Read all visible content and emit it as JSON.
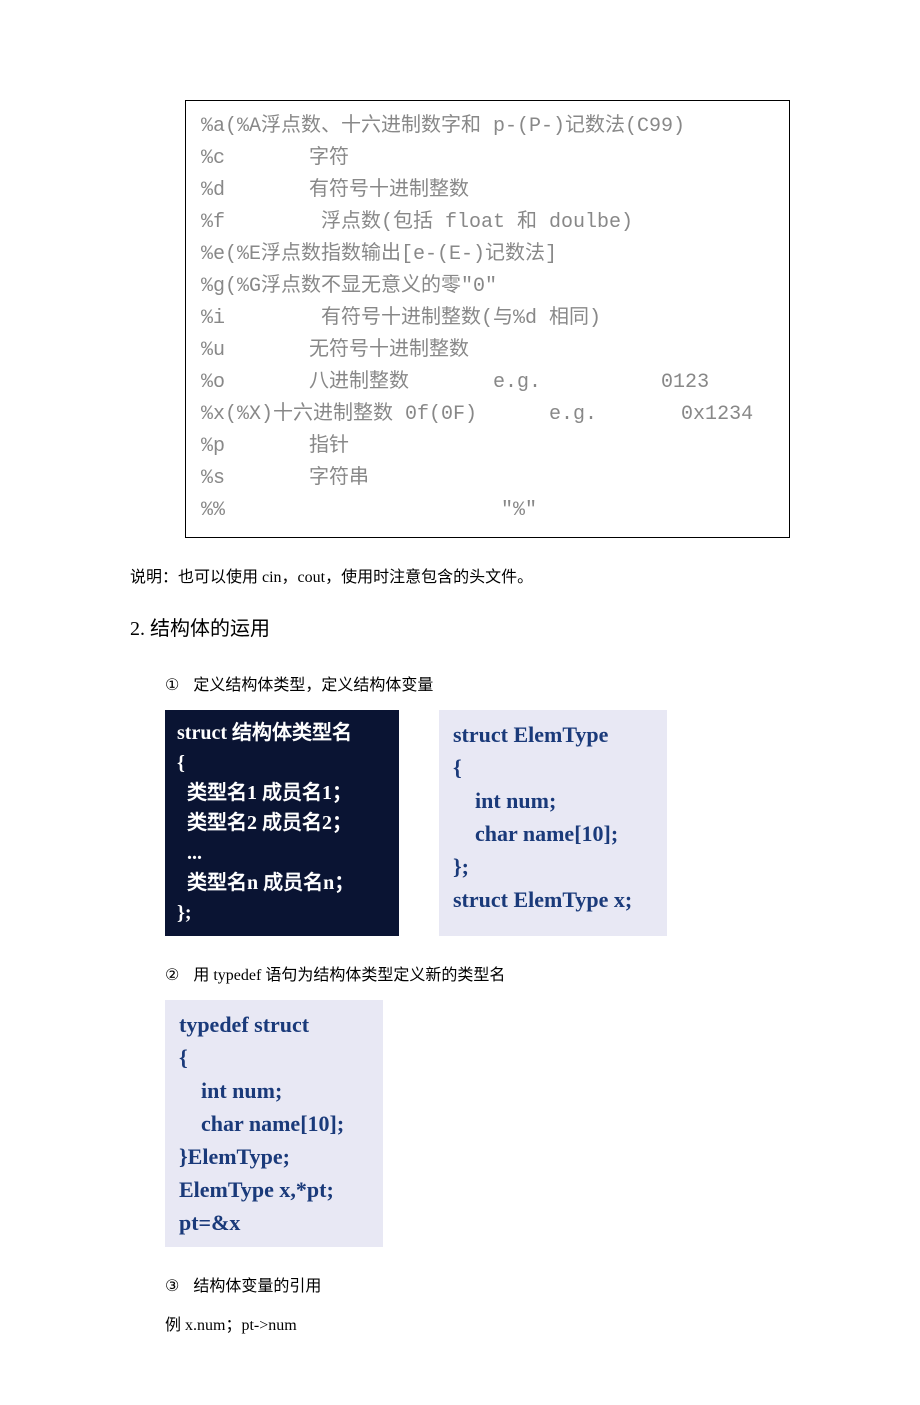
{
  "format_specifiers": [
    "%a(%A浮点数、十六进制数字和 p-(P-)记数法(C99)",
    "%c       字符",
    "%d       有符号十进制整数",
    "%f        浮点数(包括 float 和 doulbe)",
    "%e(%E浮点数指数输出[e-(E-)记数法]",
    "%g(%G浮点数不显无意义的零\"0\"",
    "%i        有符号十进制整数(与%d 相同)",
    "%u       无符号十进制整数",
    "%o       八进制整数       e.g.          0123",
    "%x(%X)十六进制整数 0f(0F)      e.g.       0x1234",
    "%p       指针",
    "%s       字符串",
    "%%                       \"%\""
  ],
  "note": "说明：也可以使用 cin，cout，使用时注意包含的头文件。",
  "section_2": "2.  结构体的运用",
  "items": {
    "i1_num": "①",
    "i1_text": "定义结构体类型，定义结构体变量",
    "i2_num": "②",
    "i2_text": "用 typedef 语句为结构体类型定义新的类型名",
    "i3_num": "③",
    "i3_text": "结构体变量的引用"
  },
  "code_dark": "struct 结构体类型名\n{\n  类型名1 成员名1；\n  类型名2 成员名2；\n  ...\n  类型名n 成员名n；\n};",
  "code_light_1": "struct ElemType\n{\n    int num;\n    char name[10];\n};\nstruct ElemType x;",
  "code_light_2": "typedef struct\n{\n    int num;\n    char name[10];\n}ElemType;\nElemType x,*pt;\npt=&x",
  "example": "例 x.num；pt->num"
}
